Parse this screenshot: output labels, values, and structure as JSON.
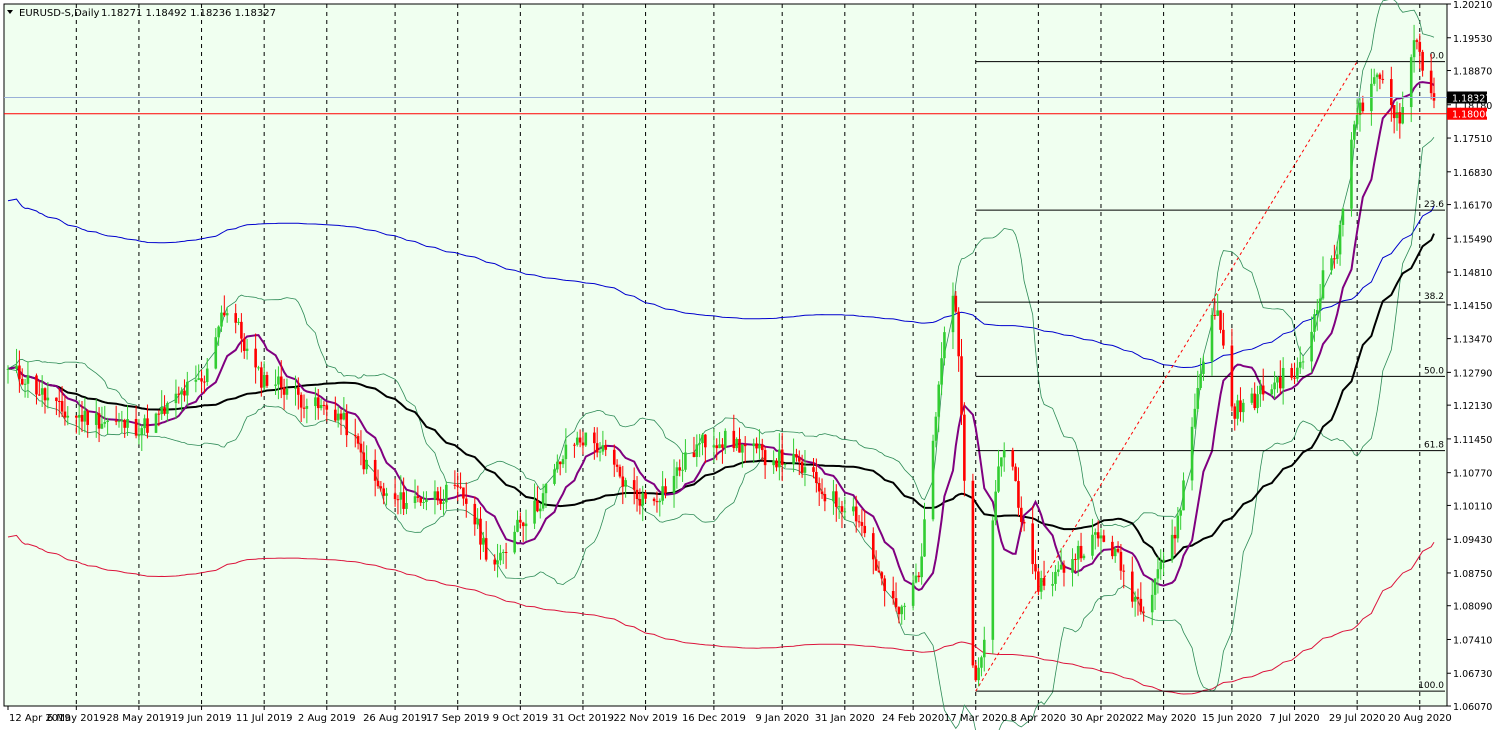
{
  "window": {
    "symbol": "EURUSD-S,Daily",
    "ohlc": "1.18271 1.18492 1.18236 1.18327",
    "menu_icon": "triangle-down-icon"
  },
  "colors": {
    "background": "#f0fff0",
    "bull": "#32cd32",
    "bear": "#ff0000",
    "ma_fast": "#800080",
    "ma_mid": "#000000",
    "bb": "#2e8b57",
    "env_upper": "#0000cd",
    "env_lower": "#dc143c",
    "fib": "#000000",
    "trend": "#ff0000"
  },
  "price_tags": {
    "current": "1.18327",
    "level": "1.18000"
  },
  "chart_data": {
    "type": "candlestick",
    "title": "EURUSD-S,Daily",
    "ylim": [
      1.0607,
      1.2021
    ],
    "y_ticks": [
      "1.20210",
      "1.19530",
      "1.18870",
      "1.18180",
      "1.17510",
      "1.16830",
      "1.16170",
      "1.15490",
      "1.14810",
      "1.14150",
      "1.13470",
      "1.12790",
      "1.12130",
      "1.11450",
      "1.10770",
      "1.10110",
      "1.09430",
      "1.08750",
      "1.08090",
      "1.07410",
      "1.06730",
      "1.06070"
    ],
    "x_ticks": [
      "12 Apr 2019",
      "6 May 2019",
      "28 May 2019",
      "19 Jun 2019",
      "11 Jul 2019",
      "2 Aug 2019",
      "26 Aug 2019",
      "17 Sep 2019",
      "9 Oct 2019",
      "31 Oct 2019",
      "22 Nov 2019",
      "16 Dec 2019",
      "9 Jan 2020",
      "31 Jan 2020",
      "24 Feb 2020",
      "17 Mar 2020",
      "8 Apr 2020",
      "30 Apr 2020",
      "22 May 2020",
      "15 Jun 2020",
      "7 Jul 2020",
      "29 Jul 2020",
      "20 Aug 2020"
    ],
    "horizontal_lines": [
      1.18327,
      1.18
    ],
    "fibonacci": {
      "high": 1.1905,
      "low": 1.0637,
      "levels": [
        {
          "label": "0.0",
          "ratio": 0
        },
        {
          "label": "23.6",
          "ratio": 0.236
        },
        {
          "label": "38.2",
          "ratio": 0.382
        },
        {
          "label": "50.0",
          "ratio": 0.5
        },
        {
          "label": "61.8",
          "ratio": 0.618
        },
        {
          "label": "100.0",
          "ratio": 1
        }
      ]
    },
    "trend_line": {
      "from": [
        "17 Mar 2020",
        1.0637
      ],
      "to": [
        "29 Jul 2020",
        1.1905
      ]
    },
    "key_points": [
      {
        "date": "12 Apr 2019",
        "close": 1.128
      },
      {
        "date": "6 May 2019",
        "close": 1.119
      },
      {
        "date": "28 May 2019",
        "close": 1.117
      },
      {
        "date": "19 Jun 2019",
        "close": 1.1255
      },
      {
        "date": "27 Jun 2019",
        "close": 1.1405
      },
      {
        "date": "11 Jul 2019",
        "close": 1.1265
      },
      {
        "date": "2 Aug 2019",
        "close": 1.1205
      },
      {
        "date": "26 Aug 2019",
        "close": 1.102
      },
      {
        "date": "17 Sep 2019",
        "close": 1.1035
      },
      {
        "date": "1 Oct 2019",
        "close": 1.0895
      },
      {
        "date": "9 Oct 2019",
        "close": 1.0985
      },
      {
        "date": "31 Oct 2019",
        "close": 1.1145
      },
      {
        "date": "22 Nov 2019",
        "close": 1.1025
      },
      {
        "date": "16 Dec 2019",
        "close": 1.1145
      },
      {
        "date": "9 Jan 2020",
        "close": 1.1105
      },
      {
        "date": "31 Jan 2020",
        "close": 1.1015
      },
      {
        "date": "20 Feb 2020",
        "close": 1.0795
      },
      {
        "date": "24 Feb 2020",
        "close": 1.0855
      },
      {
        "date": "9 Mar 2020",
        "close": 1.1435
      },
      {
        "date": "17 Mar 2020",
        "close": 1.0655
      },
      {
        "date": "27 Mar 2020",
        "close": 1.1125
      },
      {
        "date": "8 Apr 2020",
        "close": 1.0855
      },
      {
        "date": "30 Apr 2020",
        "close": 1.0945
      },
      {
        "date": "15 May 2020",
        "close": 1.0815
      },
      {
        "date": "22 May 2020",
        "close": 1.0905
      },
      {
        "date": "10 Jun 2020",
        "close": 1.1395
      },
      {
        "date": "15 Jun 2020",
        "close": 1.1205
      },
      {
        "date": "7 Jul 2020",
        "close": 1.1275
      },
      {
        "date": "21 Jul 2020",
        "close": 1.1515
      },
      {
        "date": "29 Jul 2020",
        "close": 1.1805
      },
      {
        "date": "6 Aug 2020",
        "close": 1.1865
      },
      {
        "date": "13 Aug 2020",
        "close": 1.1795
      },
      {
        "date": "18 Aug 2020",
        "close": 1.1945
      },
      {
        "date": "25 Aug 2020",
        "close": 1.1833
      }
    ],
    "grid": "vertical-dashed"
  }
}
